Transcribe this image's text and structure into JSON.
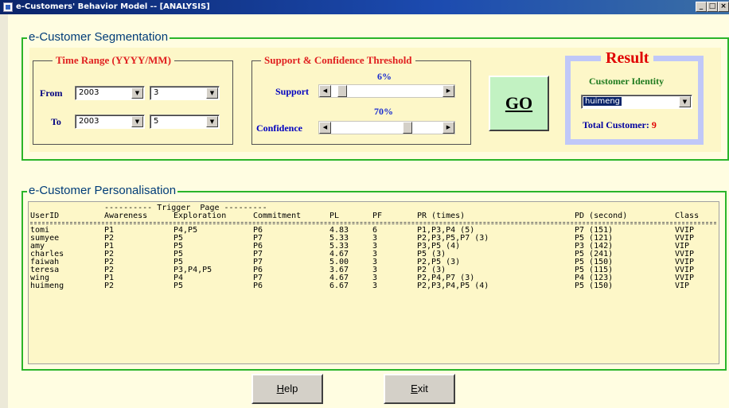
{
  "window": {
    "title": "e-Customers' Behavior Model -- [ANALYSIS]",
    "controls": [
      "_",
      "□",
      "×"
    ]
  },
  "segmentation": {
    "title": "e-Customer Segmentation",
    "time_range": {
      "title": "Time Range (YYYY/MM)",
      "from_label": "From",
      "to_label": "To",
      "from_year": "2003",
      "from_month": "3",
      "to_year": "2003",
      "to_month": "5"
    },
    "threshold": {
      "title": "Support & Confidence Threshold",
      "support_label": "Support",
      "support_value": "6%",
      "support_level": 0.06,
      "confidence_label": "Confidence",
      "confidence_value": "70%",
      "confidence_level": 0.7
    },
    "go_button": "GO",
    "result": {
      "title": "Result",
      "customer_identity_label": "Customer Identity",
      "selected_customer": "huimeng",
      "total_label": "Total Customer:",
      "total_value": "9"
    }
  },
  "personalisation": {
    "title": "e-Customer Personalisation",
    "group_header": "---------- Trigger  Page ---------",
    "columns": [
      "UserID",
      "Awareness",
      "Exploration",
      "Commitment",
      "PL",
      "PF",
      "PR (times)",
      "PD (second)",
      "Class"
    ],
    "rows": [
      [
        "tomi",
        "P1",
        "P4,P5",
        "P6",
        "4.83",
        "6",
        "P1,P3,P4 (5)",
        "P7 (151)",
        "VVIP"
      ],
      [
        "sumyee",
        "P2",
        "P5",
        "P7",
        "5.33",
        "3",
        "P2,P3,P5,P7 (3)",
        "P5 (121)",
        "VVIP"
      ],
      [
        "amy",
        "P1",
        "P5",
        "P6",
        "5.33",
        "3",
        "P3,P5 (4)",
        "P3 (142)",
        "VIP"
      ],
      [
        "charles",
        "P2",
        "P5",
        "P7",
        "4.67",
        "3",
        "P5 (3)",
        "P5 (241)",
        "VVIP"
      ],
      [
        "faiwah",
        "P2",
        "P5",
        "P7",
        "5.00",
        "3",
        "P2,P5 (3)",
        "P5 (150)",
        "VVIP"
      ],
      [
        "teresa",
        "P2",
        "P3,P4,P5",
        "P6",
        "3.67",
        "3",
        "P2 (3)",
        "P5 (115)",
        "VVIP"
      ],
      [
        "wing",
        "P1",
        "P4",
        "P7",
        "4.67",
        "3",
        "P2,P4,P7 (3)",
        "P4 (123)",
        "VVIP"
      ],
      [
        "huimeng",
        "P2",
        "P5",
        "P6",
        "6.67",
        "3",
        "P2,P3,P4,P5 (4)",
        "P5 (150)",
        "VIP"
      ]
    ]
  },
  "buttons": {
    "help_first": "H",
    "help_rest": "elp",
    "exit_first": "E",
    "exit_rest": "xit"
  },
  "icons": {
    "dropdown": "chevron-down-icon",
    "scroll_left": "arrow-left-icon",
    "scroll_right": "arrow-right-icon"
  },
  "colors": {
    "frame_green": "#2ab52a",
    "panel_yellow": "#fdf7c8",
    "title_red": "#e02020",
    "go_green": "#c2f2c2",
    "result_border": "#c0c8f8"
  }
}
